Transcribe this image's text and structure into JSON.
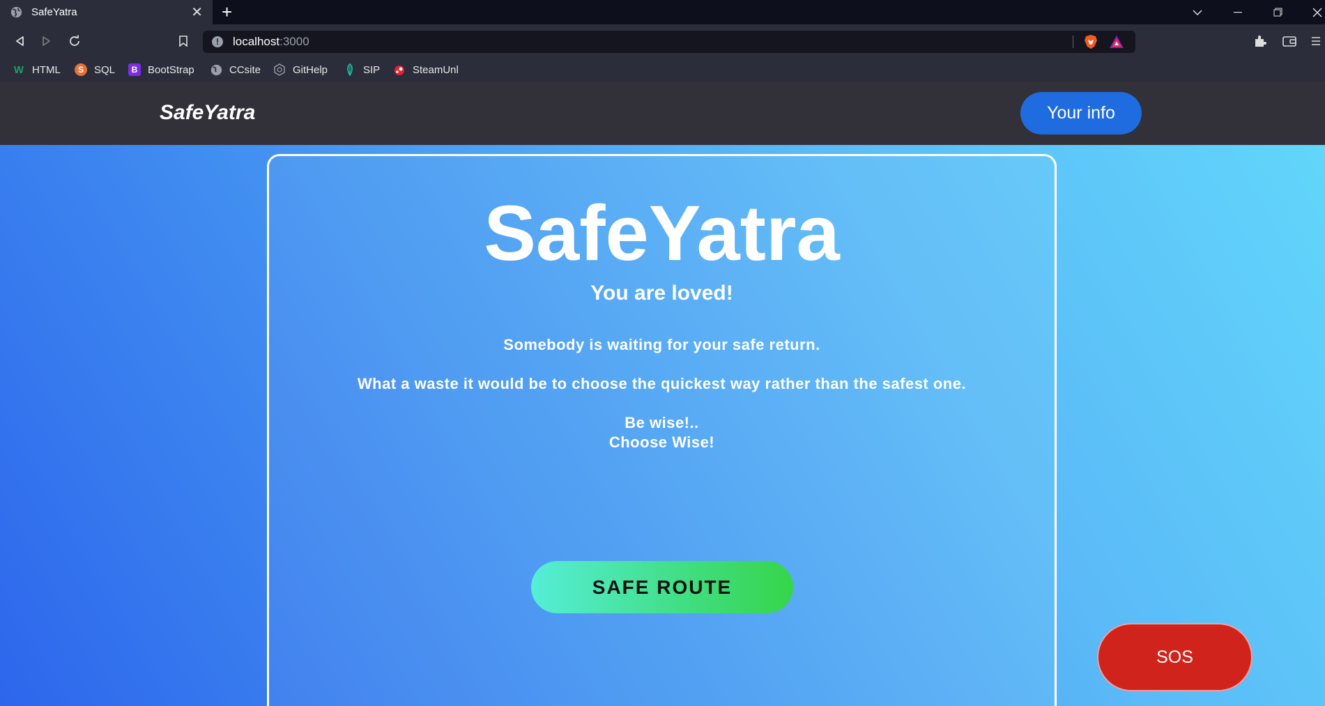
{
  "browser": {
    "tab_title": "SafeYatra",
    "tab_close": "✕",
    "new_tab": "+",
    "url_host": "localhost",
    "url_port": ":3000",
    "bookmarks": [
      {
        "label": "HTML",
        "icon": "w-icon",
        "glyph": "W",
        "color": "#1aa260"
      },
      {
        "label": "SQL",
        "icon": "s-icon",
        "glyph": "S",
        "color": "#e8713a"
      },
      {
        "label": "BootStrap",
        "icon": "bootstrap-icon",
        "glyph": "B",
        "color": "#7b2fe0"
      },
      {
        "label": "CCsite",
        "icon": "globe-icon",
        "glyph": "",
        "color": "#9aa0aa"
      },
      {
        "label": "GitHelp",
        "icon": "github-icon",
        "glyph": "",
        "color": "#9aa0aa"
      },
      {
        "label": "SIP",
        "icon": "leaf-icon",
        "glyph": "",
        "color": "#1fb89a"
      },
      {
        "label": "SteamUnl",
        "icon": "steam-icon",
        "glyph": "",
        "color": "#e0242f"
      }
    ]
  },
  "navbar": {
    "brand": "SafeYatra",
    "info_button": "Your info"
  },
  "hero": {
    "title": "SafeYatra",
    "subtitle": "You are loved!",
    "line1": "Somebody is waiting for your safe return.",
    "line2": "What a waste it would be to choose the quickest way rather than the safest one.",
    "line3": "Be wise!..",
    "line4": "Choose Wise!",
    "cta": "SAFE ROUTE"
  },
  "sos": "SOS",
  "colors": {
    "navbar_bg": "#323039",
    "info_button_bg": "#1e6ce0",
    "sos_bg": "#d0231b",
    "cta_gradient_start": "#55eed8",
    "cta_gradient_end": "#36d54a"
  }
}
